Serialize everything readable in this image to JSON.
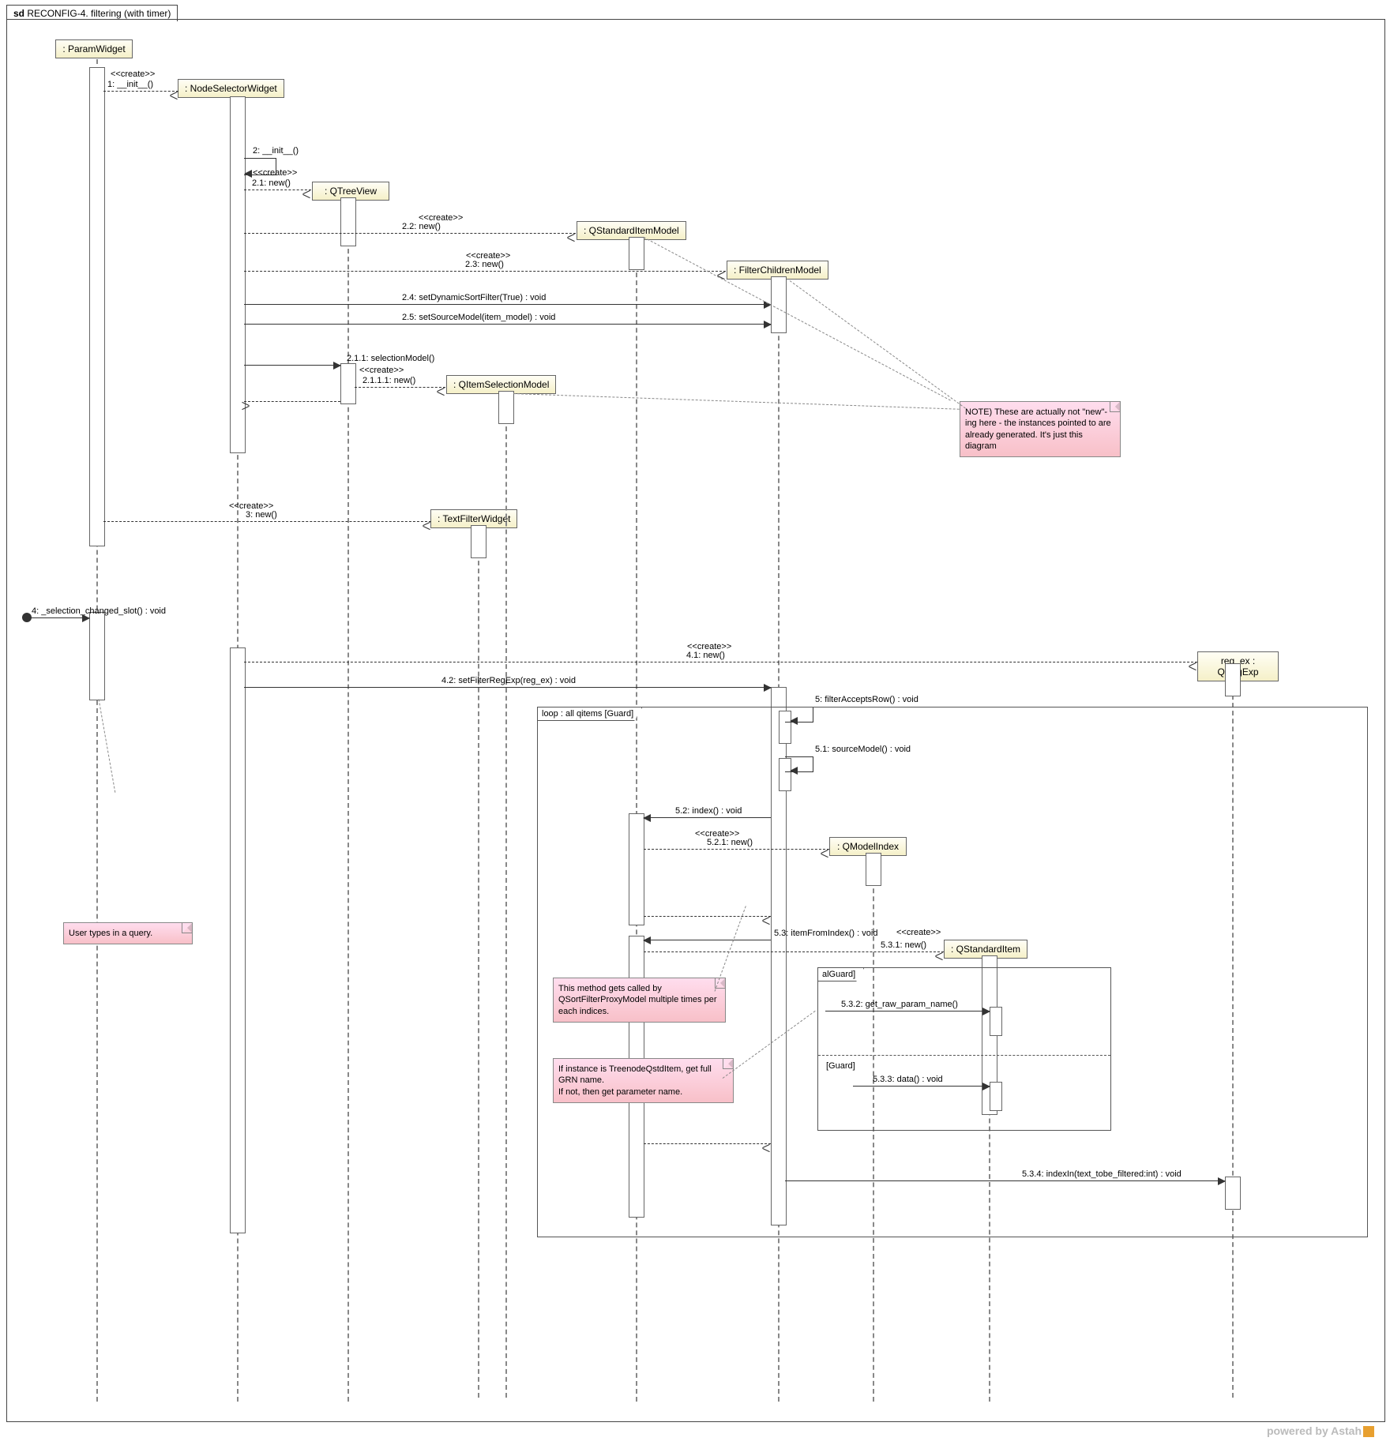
{
  "diagram": {
    "title_prefix": "sd",
    "title": "RECONFIG-4. filtering (with timer)"
  },
  "lifelines": {
    "param_widget": ": ParamWidget",
    "node_selector": ": NodeSelectorWidget",
    "qtreeview": ": QTreeView",
    "qstditemmodel": ": QStandardItemModel",
    "filterchildren": ": FilterChildrenModel",
    "qitemsel": ": QItemSelectionModel",
    "textfilter": ": TextFilterWidget",
    "regex": "reg_ex : QRegExp",
    "qmodelindex": ": QModelIndex",
    "qstditem": ": QStandardItem"
  },
  "stereotype": {
    "create": "<<create>>"
  },
  "messages": {
    "m1": "1: __init__()",
    "m2": "2: __init__()",
    "m2_1": "2.1: new()",
    "m2_2": "2.2: new()",
    "m2_3": "2.3: new()",
    "m2_4": "2.4: setDynamicSortFilter(True) : void",
    "m2_5": "2.5: setSourceModel(item_model) : void",
    "m2_1_1": "2.1.1: selectionModel()",
    "m2_1_1_1": "2.1.1.1: new()",
    "m3": "3: new()",
    "m4": "4: _selection_changed_slot() : void",
    "m4_1": "4.1: new()",
    "m4_2": "4.2: setFilterRegExp(reg_ex) : void",
    "m5": "5: filterAcceptsRow() : void",
    "m5_1": "5.1: sourceModel() : void",
    "m5_2": "5.2: index() : void",
    "m5_2_1": "5.2.1: new()",
    "m5_3": "5.3: itemFromIndex() : void",
    "m5_3_1": "5.3.1: new()",
    "m5_3_2": "5.3.2: get_raw_param_name()",
    "m5_3_3": "5.3.3: data() : void",
    "m5_3_4": "5.3.4: indexIn(text_tobe_filtered:int) : void"
  },
  "fragments": {
    "loop": "loop : all qitems  [Guard]",
    "alt": "alGuard]",
    "guard": "[Guard]"
  },
  "notes": {
    "note1": "NOTE) These are actually not \"new\"-ing here - the instances pointed to are already generated. It's just this diagram",
    "note2": "User types in a query.",
    "note3": "This method gets called by QSortFilterProxyModel multiple times per each indices.",
    "note4": "If instance is TreenodeQstdItem, get full GRN name.\nIf not, then get parameter name."
  },
  "footer": "powered by Astah"
}
